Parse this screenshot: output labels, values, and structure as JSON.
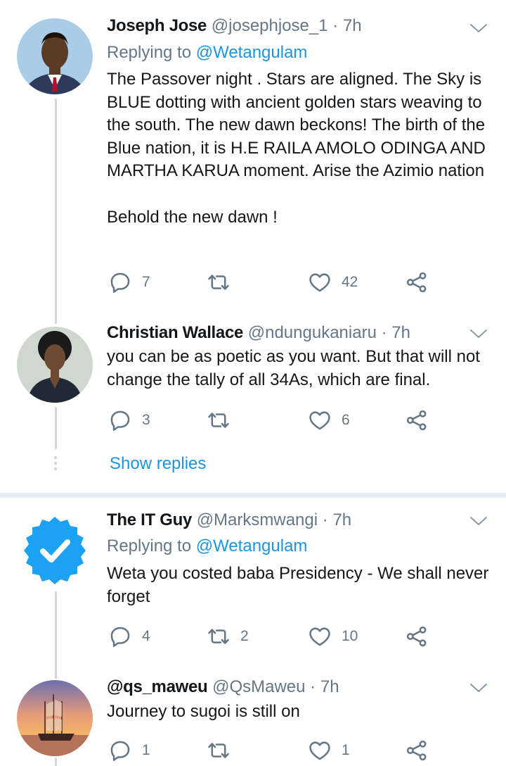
{
  "tweets": [
    {
      "name": "Joseph Jose",
      "handle": "@josephjose_1",
      "dot": "·",
      "time": "7h",
      "replying_label": "Replying to",
      "replying_to": "@Wetangulam",
      "text": "The Passover night . Stars are aligned. The Sky is BLUE dotting with ancient golden stars weaving to the south. The new dawn beckons! The birth of the Blue nation, it is H.E RAILA AMOLO ODINGA AND MARTHA KARUA moment. Arise the Azimio nation\n\nBehold the new dawn !",
      "replies": "7",
      "retweets": "",
      "likes": "42"
    },
    {
      "name": "Christian Wallace",
      "handle": "@ndungukaniaru",
      "dot": "·",
      "time": "7h",
      "text": "you can be as poetic as you want. But that will not change the tally of all 34As, which are final.",
      "replies": "3",
      "retweets": "",
      "likes": "6"
    },
    {
      "name": "The IT Guy",
      "handle": "@Marksmwangi",
      "dot": "·",
      "time": "7h",
      "replying_label": "Replying to",
      "replying_to": "@Wetangulam",
      "text": "Weta you costed baba Presidency - We shall never forget",
      "replies": "4",
      "retweets": "2",
      "likes": "10"
    },
    {
      "name": "@qs_maweu",
      "handle": "@QsMaweu",
      "dot": "·",
      "time": "7h",
      "text": "Journey to sugoi is still on",
      "replies": "1",
      "retweets": "",
      "likes": "1"
    }
  ],
  "show_replies_label": "Show replies",
  "colors": {
    "link": "#1b95e0",
    "muted": "#657786",
    "thread_line": "#ccd6dd",
    "separator": "#e6ecf0",
    "verified_badge": "#1da1f2"
  },
  "icons": {
    "reply": "reply-icon",
    "retweet": "retweet-icon",
    "like": "heart-icon",
    "share": "share-icon",
    "menu": "chevron-down-icon"
  }
}
